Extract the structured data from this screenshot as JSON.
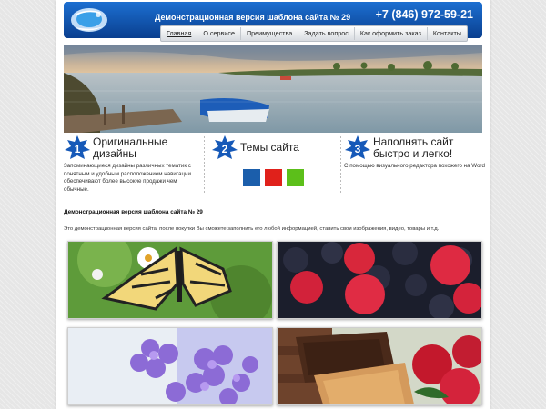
{
  "header": {
    "site_title": "Демонстрационная версия шаблона сайта № 29",
    "phone": "+7 (846) 972-59-21"
  },
  "nav": {
    "items": [
      "Главная",
      "О сервисе",
      "Преимущества",
      "Задать вопрос",
      "Как оформить заказ",
      "Контакты"
    ]
  },
  "features": [
    {
      "number": "1",
      "title_line1": "Оригинальные",
      "title_line2": "дизайны",
      "text_line1": "Запоминающиеся дизайны различных тематик с",
      "text_line2": "понятным и удобным расположением навигации",
      "text_line3": "обеспечивают более высокие продажи чем обычные."
    },
    {
      "number": "2",
      "title_line1": "Темы сайта"
    },
    {
      "number": "3",
      "title_line1": "Наполнять сайт",
      "title_line2": "быстро и легко!",
      "text_line1": "С помощью визуального редактора похожего на Word"
    }
  ],
  "theme_colors": [
    "#1b5eab",
    "#e0211b",
    "#5cbf1a"
  ],
  "content": {
    "title": "Демонстрационная версия шаблона сайта № 29",
    "text": "Это демонстрационная версия сайта, после покупки Вы сможете заполнить его любой информацией, ставить свои изображения, видео, товары и т.д."
  },
  "gallery": [
    "butterfly",
    "berries",
    "lilac",
    "chocolate-roses"
  ]
}
